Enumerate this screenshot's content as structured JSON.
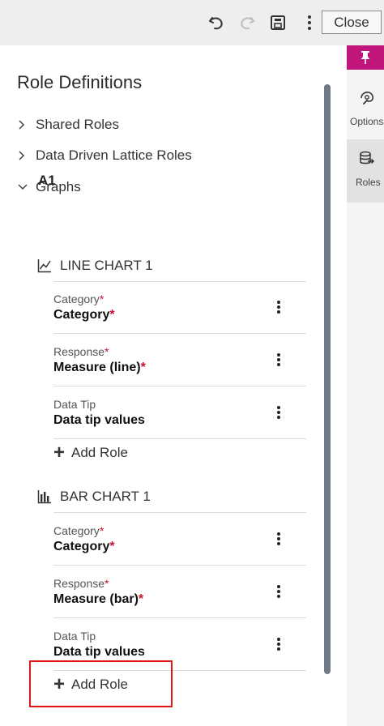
{
  "toolbar": {
    "undo_icon": "undo-icon",
    "redo_icon": "redo-icon",
    "save_icon": "save-icon",
    "more_icon": "more-vertical-icon",
    "close_label": "Close"
  },
  "panel": {
    "title": "Role Definitions",
    "tree": [
      {
        "label": "Shared Roles",
        "expanded": false
      },
      {
        "label": "Data Driven Lattice Roles",
        "expanded": false
      },
      {
        "label": "Graphs",
        "expanded": true
      }
    ],
    "section": "A1",
    "charts": [
      {
        "title": "LINE CHART 1",
        "icon": "line-chart-icon",
        "roles": [
          {
            "label": "Category",
            "label_req": "*",
            "value": "Category",
            "value_req": "*"
          },
          {
            "label": "Response",
            "label_req": "*",
            "value": "Measure (line)",
            "value_req": "*"
          },
          {
            "label": "Data Tip",
            "label_req": "",
            "value": "Data tip values",
            "value_req": ""
          }
        ],
        "add_role": "Add Role"
      },
      {
        "title": "BAR CHART 1",
        "icon": "bar-chart-icon",
        "roles": [
          {
            "label": "Category",
            "label_req": "*",
            "value": "Category",
            "value_req": "*"
          },
          {
            "label": "Response",
            "label_req": "*",
            "value": "Measure (bar)",
            "value_req": "*"
          },
          {
            "label": "Data Tip",
            "label_req": "",
            "value": "Data tip values",
            "value_req": ""
          }
        ],
        "add_role": "Add Role"
      }
    ]
  },
  "rail": {
    "pin_icon": "pin-icon",
    "tabs": [
      {
        "label": "Options",
        "icon": "options-icon",
        "active": false
      },
      {
        "label": "Roles",
        "icon": "roles-icon",
        "active": true
      }
    ]
  },
  "colors": {
    "accent_pin": "#c0157a",
    "required": "#c8102e",
    "highlight": "#e01818",
    "scroll_thumb": "#6f7a87"
  }
}
